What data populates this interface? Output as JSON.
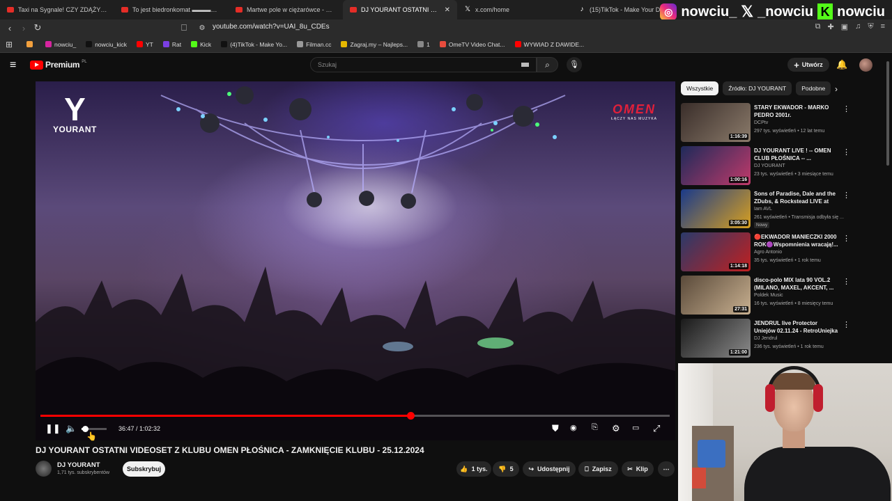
{
  "browser": {
    "tabs": [
      {
        "title": "Taxi na Sygnale! CZY ZDĄŻYMY NA C",
        "icon": "youtube-icon",
        "active": false
      },
      {
        "title": "To jest biedronkomat ▬▬▬▬▬",
        "icon": "youtube-icon",
        "active": false
      },
      {
        "title": "Martwe pole w ciężarówce - w pr",
        "icon": "youtube-icon",
        "active": false
      },
      {
        "title": "DJ YOURANT OSTATNI VIDEO",
        "icon": "youtube-icon",
        "active": true
      },
      {
        "title": "x.com/home",
        "icon": "x-icon",
        "active": false
      },
      {
        "title": "(15)TikTok - Make Your Day",
        "icon": "tiktok-icon",
        "active": false
      }
    ],
    "tab_close": "✕",
    "url": "youtube.com/watch?v=UAI_8u_CDEs",
    "bookmarks": [
      {
        "label": "",
        "color": "#f2a03d"
      },
      {
        "label": "nowciu_",
        "color": "#d6249f"
      },
      {
        "label": "nowciu_kick",
        "color": "#111111"
      },
      {
        "label": "YT",
        "color": "#ff0000"
      },
      {
        "label": "Rat",
        "color": "#7b3fe4"
      },
      {
        "label": "Kick",
        "color": "#53fc18"
      },
      {
        "label": "(4)TikTok - Make Yo...",
        "color": "#111111"
      },
      {
        "label": "Filman.cc",
        "color": "#999999"
      },
      {
        "label": "Zagraj.my – Najleps...",
        "color": "#e6b800"
      },
      {
        "label": "1",
        "color": "#888888"
      },
      {
        "label": "OmeTV Video Chat...",
        "color": "#e84c3d"
      },
      {
        "label": "WYWIAD Z DAWIDE...",
        "color": "#ff0000"
      }
    ]
  },
  "stream_overlay": {
    "handles": [
      "nowciu_",
      "_nowciu",
      "nowciu"
    ]
  },
  "header": {
    "logo_text": "Premium",
    "logo_region": "PL",
    "search_placeholder": "Szukaj",
    "create_label": "Utwórz"
  },
  "player": {
    "channel_logo_text": "YOURANT",
    "brand_logo": "OMEN",
    "brand_tagline": "ŁĄCZY NAS MUZYKA",
    "current_time": "36:47",
    "duration": "1:02:32",
    "time_display": "36:47 / 1:02:32",
    "progress_fraction": 0.588,
    "volume_fraction": 0.15
  },
  "video": {
    "title": "DJ YOURANT OSTATNI VIDEOSET Z KLUBU OMEN PŁOŚNICA - ZAMKNIĘCIE KLUBU - 25.12.2024",
    "channel": "DJ YOURANT",
    "subscribers": "1,71 tys. subskrybentów",
    "subscribe_label": "Subskrybuj",
    "likes": "1 tys.",
    "dislikes": "5",
    "share_label": "Udostępnij",
    "save_label": "Zapisz",
    "clip_label": "Klip"
  },
  "sidebar": {
    "chips": [
      "Wszystkie",
      "Źródło: DJ YOURANT",
      "Podobne"
    ],
    "items": [
      {
        "title": "STARY EKWADOR - MARKO PEDRO 2001r.",
        "channel": "DCPtv",
        "meta": "297 tys. wyświetleń • 12 lat temu",
        "duration": "1:16:39",
        "badge": "",
        "thumb_colors": [
          "#3a2e2a",
          "#8a7a6a"
        ]
      },
      {
        "title": "DJ YOURANT LIVE ! -- OMEN CLUB PŁOŚNICA -- ...",
        "channel": "DJ YOURANT",
        "meta": "23 tys. wyświetleń • 3 miesiące temu",
        "duration": "1:00:16",
        "badge": "",
        "thumb_colors": [
          "#1e2a5a",
          "#c03a6a"
        ]
      },
      {
        "title": "Sons of Paradise, Dale and the ZDubs, & Rockstead LIVE at O...",
        "channel": "Iam AVL",
        "meta": "261 wyświetleń • Transmisja odbyła się ...",
        "duration": "3:05:30",
        "badge": "Nowy",
        "thumb_colors": [
          "#1a3a8a",
          "#d8a020"
        ]
      },
      {
        "title": "🔴EKWADOR MANIECZKI 2000 ROK🟣Wspomnienia wracają!...",
        "channel": "Agro Antonio",
        "meta": "35 tys. wyświetleń • 1 rok temu",
        "duration": "1:14:18",
        "badge": "",
        "thumb_colors": [
          "#2a3a6a",
          "#c02020"
        ]
      },
      {
        "title": "disco-polo MIX lata 90 VOL.2 (MILANO, MAXEL, AKCENT, ...",
        "channel": "Poldek Music",
        "meta": "16 tys. wyświetleń • 8 miesięcy temu",
        "duration": "27:31",
        "badge": "",
        "thumb_colors": [
          "#5a4a3a",
          "#c8b090"
        ]
      },
      {
        "title": "JENDRUL live Protector Uniejów 02.11.24 - RetroUniejka - ...",
        "channel": "DJ Jendrul",
        "meta": "236 tys. wyświetleń • 1 rok temu",
        "duration": "1:21:00",
        "badge": "",
        "thumb_colors": [
          "#1a1a1a",
          "#8a8a8a"
        ]
      }
    ]
  }
}
